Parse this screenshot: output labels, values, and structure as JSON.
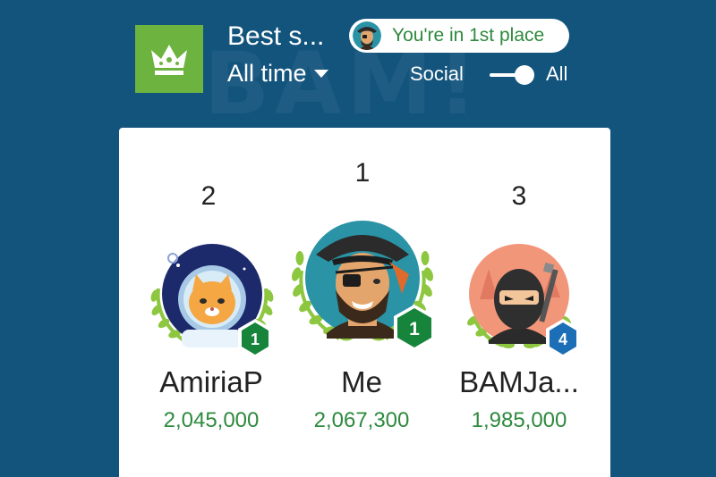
{
  "header": {
    "title": "Best s...",
    "time_filter": "All time",
    "place_text": "You're in 1st place",
    "scope": {
      "left_label": "Social",
      "right_label": "All",
      "selected": "All"
    },
    "watermark": "BAM!"
  },
  "leaderboard": [
    {
      "rank": "2",
      "name": "AmiriaP",
      "score": "2,045,000",
      "level": "1",
      "level_color": "#17843c"
    },
    {
      "rank": "1",
      "name": "Me",
      "score": "2,067,300",
      "level": "1",
      "level_color": "#17843c"
    },
    {
      "rank": "3",
      "name": "BAMJa...",
      "score": "1,985,000",
      "level": "4",
      "level_color": "#1c6fb6"
    }
  ],
  "colors": {
    "background": "#13547d",
    "accent_green": "#6db33f",
    "score_green": "#2e8a3e",
    "laurel": "#8dc63f"
  },
  "icons": [
    "crown-icon",
    "dropdown-caret-icon",
    "laurel-wreath-icon",
    "level-hexagon-icon"
  ]
}
